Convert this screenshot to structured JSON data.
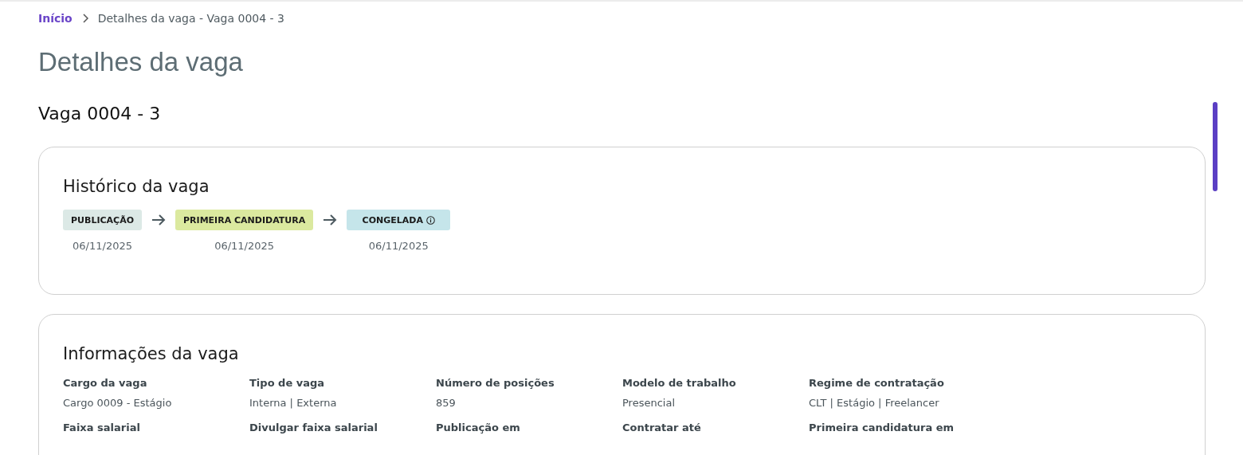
{
  "breadcrumb": [
    {
      "label": "Início",
      "kind": "link"
    },
    {
      "label": "Detalhes da vaga - Vaga 0004 - 3",
      "kind": "current"
    }
  ],
  "page_title": "Detalhes da vaga",
  "job_title": "Vaga 0004 - 3",
  "history": {
    "title": "Histórico da vaga",
    "steps": [
      {
        "label": "PUBLICAÇÃO",
        "date": "06/11/2025",
        "color": "#dce9e6",
        "info": false
      },
      {
        "label": "PRIMEIRA CANDIDATURA",
        "date": "06/11/2025",
        "color": "#dbe99f",
        "info": false
      },
      {
        "label": "CONGELADA",
        "date": "06/11/2025",
        "color": "#c5e5ea",
        "info": true
      }
    ]
  },
  "info": {
    "title": "Informações da vaga",
    "fields": [
      {
        "label": "Cargo da vaga",
        "value": "Cargo 0009 - Estágio"
      },
      {
        "label": "Tipo de vaga",
        "value": "Interna | Externa"
      },
      {
        "label": "Número de posições",
        "value": "859"
      },
      {
        "label": "Modelo de trabalho",
        "value": "Presencial"
      },
      {
        "label": "Regime de contratação",
        "value": "CLT | Estágio | Freelancer"
      },
      {
        "label": "Faixa salarial"
      },
      {
        "label": "Divulgar faixa salarial"
      },
      {
        "label": "Publicação em"
      },
      {
        "label": "Contratar até"
      },
      {
        "label": "Primeira candidatura em"
      }
    ]
  }
}
